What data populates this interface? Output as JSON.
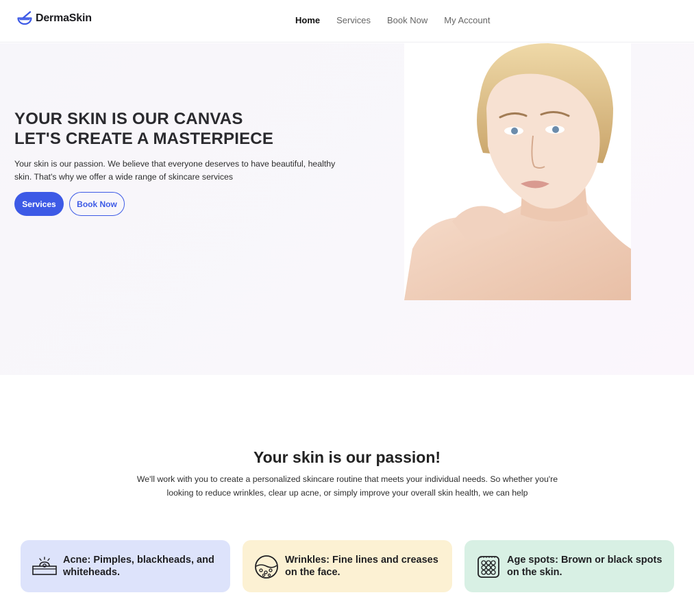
{
  "brand": {
    "name": "DermaSkin"
  },
  "nav": {
    "items": [
      {
        "label": "Home",
        "active": true
      },
      {
        "label": "Services",
        "active": false
      },
      {
        "label": "Book Now",
        "active": false
      },
      {
        "label": "My Account",
        "active": false
      }
    ]
  },
  "hero": {
    "title_line1": "YOUR SKIN IS OUR CANVAS",
    "title_line2": "LET'S CREATE A MASTERPIECE",
    "text": "Your skin is our passion. We believe that everyone deserves to have beautiful, healthy skin. That's why we offer a wide range of skincare services",
    "primary_button": "Services",
    "secondary_button": "Book Now"
  },
  "passion": {
    "title": "Your skin is our passion!",
    "text": "We'll work with you to create a personalized skincare routine that meets your individual needs. So whether you're looking to reduce wrinkles, clear up acne, or simply improve your overall skin health, we can help"
  },
  "cards": [
    {
      "icon": "acne-icon",
      "text": "Acne: Pimples, blackheads, and whiteheads."
    },
    {
      "icon": "wrinkles-icon",
      "text": "Wrinkles: Fine lines and creases on the face."
    },
    {
      "icon": "age-spots-icon",
      "text": "Age spots: Brown or black spots on the skin."
    }
  ],
  "colors": {
    "accent": "#3d5ae6",
    "card_blue": "#dde3fb",
    "card_yellow": "#fcf1d3",
    "card_green": "#d8f0e4"
  }
}
